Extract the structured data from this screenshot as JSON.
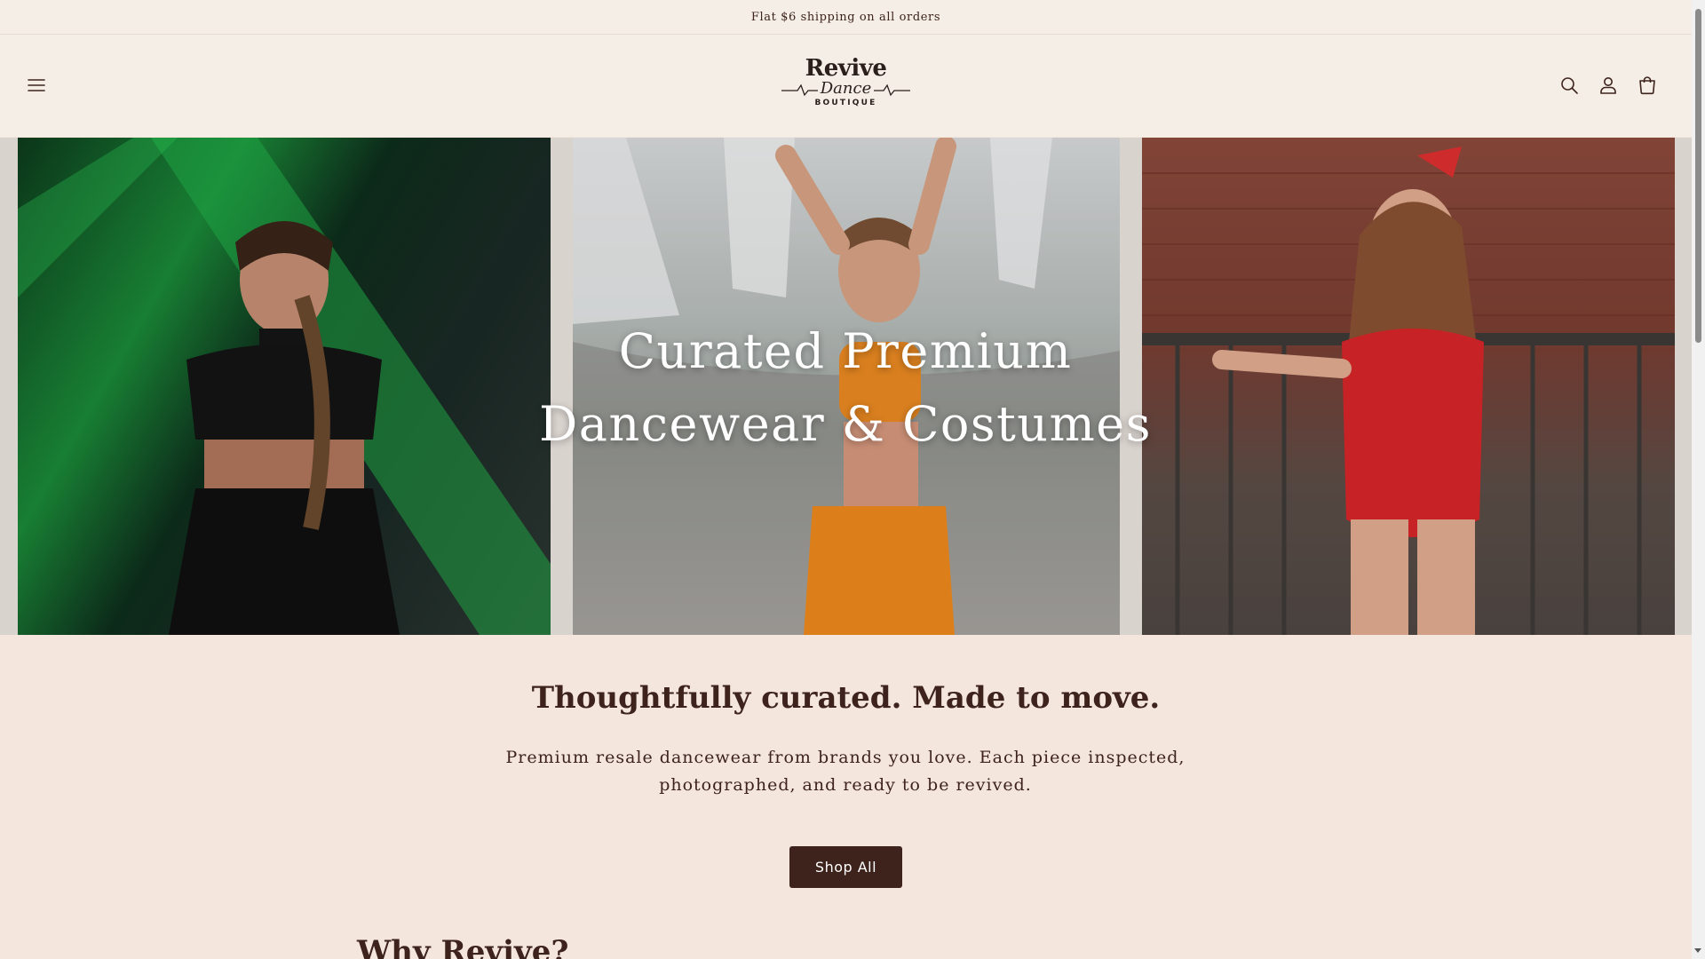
{
  "announcement": {
    "text": "Flat $6 shipping on all orders"
  },
  "header": {
    "logo": {
      "line1": "Revive",
      "line2": "Dance",
      "line3": "BOUTIQUE"
    },
    "icons": {
      "menu": "menu-icon",
      "search": "search-icon",
      "account": "account-icon",
      "cart": "cart-icon"
    }
  },
  "hero": {
    "title_line1": "Curated Premium",
    "title_line2": "Dancewear & Costumes"
  },
  "intro": {
    "heading": "Thoughtfully curated. Made to move.",
    "text": "Premium resale dancewear from brands you love. Each piece inspected, photographed, and ready to be revived.",
    "button_label": "Shop All"
  },
  "why": {
    "heading": "Why Revive?"
  },
  "colors": {
    "background": "#f4e6dc",
    "header_bg": "#f4eee6",
    "text": "#3d231c",
    "button_bg": "#3d231c"
  }
}
